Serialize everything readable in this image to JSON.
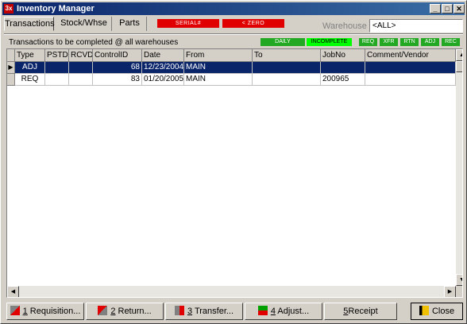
{
  "window": {
    "title": "Inventory Manager",
    "logo": "3x"
  },
  "tabs": [
    {
      "label": "Transactions"
    },
    {
      "label": "Stock/Whse"
    },
    {
      "label": "Parts"
    }
  ],
  "badges": {
    "serial": "SERIAL#",
    "zero": "< ZERO"
  },
  "warehouse": {
    "label": "Warehouse",
    "value": "<ALL>"
  },
  "info_text": "Transactions to be completed @ all warehouses",
  "status_badges": [
    "DAILY",
    "INCOMPLETE"
  ],
  "type_badges": [
    "REQ",
    "XFR",
    "RTN",
    "ADJ",
    "REC"
  ],
  "table": {
    "columns": [
      "Type",
      "PSTD",
      "RCVD",
      "ControlID",
      "Date",
      "From",
      "To",
      "JobNo",
      "Comment/Vendor"
    ],
    "rows": [
      [
        "ADJ",
        "",
        "",
        "68",
        "12/23/2004",
        "MAIN",
        "",
        "",
        ""
      ],
      [
        "REQ",
        "",
        "",
        "83",
        "01/20/2005",
        "MAIN",
        "",
        "200965",
        ""
      ]
    ]
  },
  "buttons": {
    "requisition": {
      "key": "1",
      "label": "Requisition..."
    },
    "return": {
      "key": "2",
      "label": "Return..."
    },
    "transfer": {
      "key": "3",
      "label": "Transfer..."
    },
    "adjust": {
      "key": "4",
      "label": "Adjust..."
    },
    "receipt": {
      "key": "5",
      "label": "Receipt"
    },
    "close": {
      "label": "Close"
    }
  },
  "colors": {
    "title_bar": "#0a246a",
    "selection": "#0a246a",
    "alert_red": "#e00000",
    "badge_green": "#22a822",
    "badge_bright_green": "#00ff00"
  }
}
